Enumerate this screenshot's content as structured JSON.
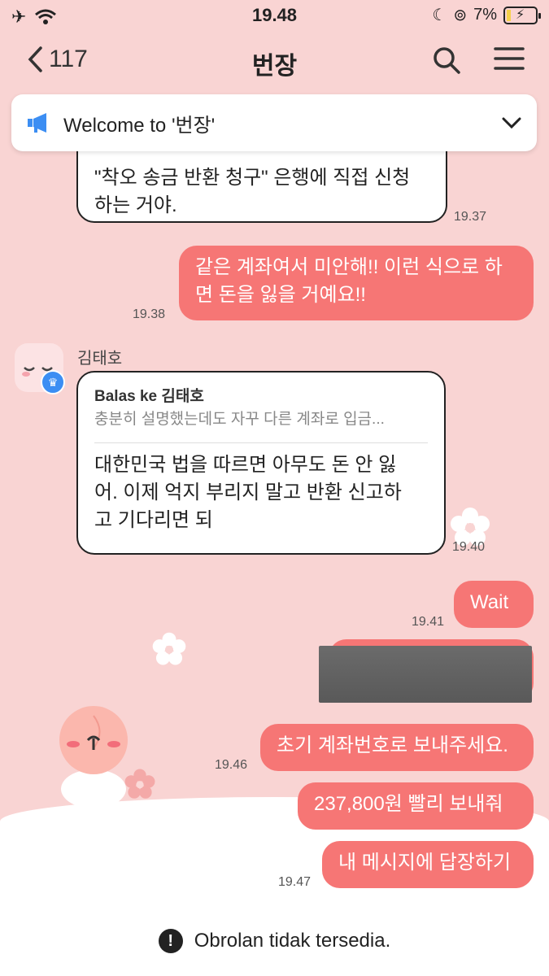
{
  "status": {
    "time": "19.48",
    "battery": "7%"
  },
  "header": {
    "back_count": "117",
    "title": "번장"
  },
  "notice": {
    "text": "Welcome to '번장'"
  },
  "messages": {
    "m1_text": "는 돈을 수 있는 유일한 방법은 방법은 \"착오 송금 반환 청구\" 은행에 직접 신청하는 거야.",
    "m1_line1": "\"착오 송금 반환 청구\" 은행에 직접 신청",
    "m1_line2": "하는 거야.",
    "m1_time": "19.37",
    "m2_line1": "같은 계좌여서 미안해!! 이런 식으로 하",
    "m2_line2": "면 돈을 잃을 거예요!!",
    "m2_time": "19.38",
    "sender": "김태호",
    "reply_head": "Balas ke 김태호",
    "reply_preview": "충분히 설명했는데도 자꾸 다른 계좌로 입금...",
    "m3_line1": "대한민국 법을 따르면 아무도 돈 안 잃",
    "m3_line2": "어. 이제 억지 부리지 말고 반환 신고하",
    "m3_line3": "고 기다리면 되",
    "m3_time": "19.40",
    "m4_text": "Wait",
    "m4_time": "19.41",
    "m5_text": "초기 계좌번호로 보내주세요.",
    "m5_time": "19.46",
    "m6_text": "237,800원 빨리 보내줘",
    "m7_text": "내 메시지에 답장하기",
    "m7_time": "19.47"
  },
  "footer": {
    "text": "Obrolan tidak tersedia."
  }
}
